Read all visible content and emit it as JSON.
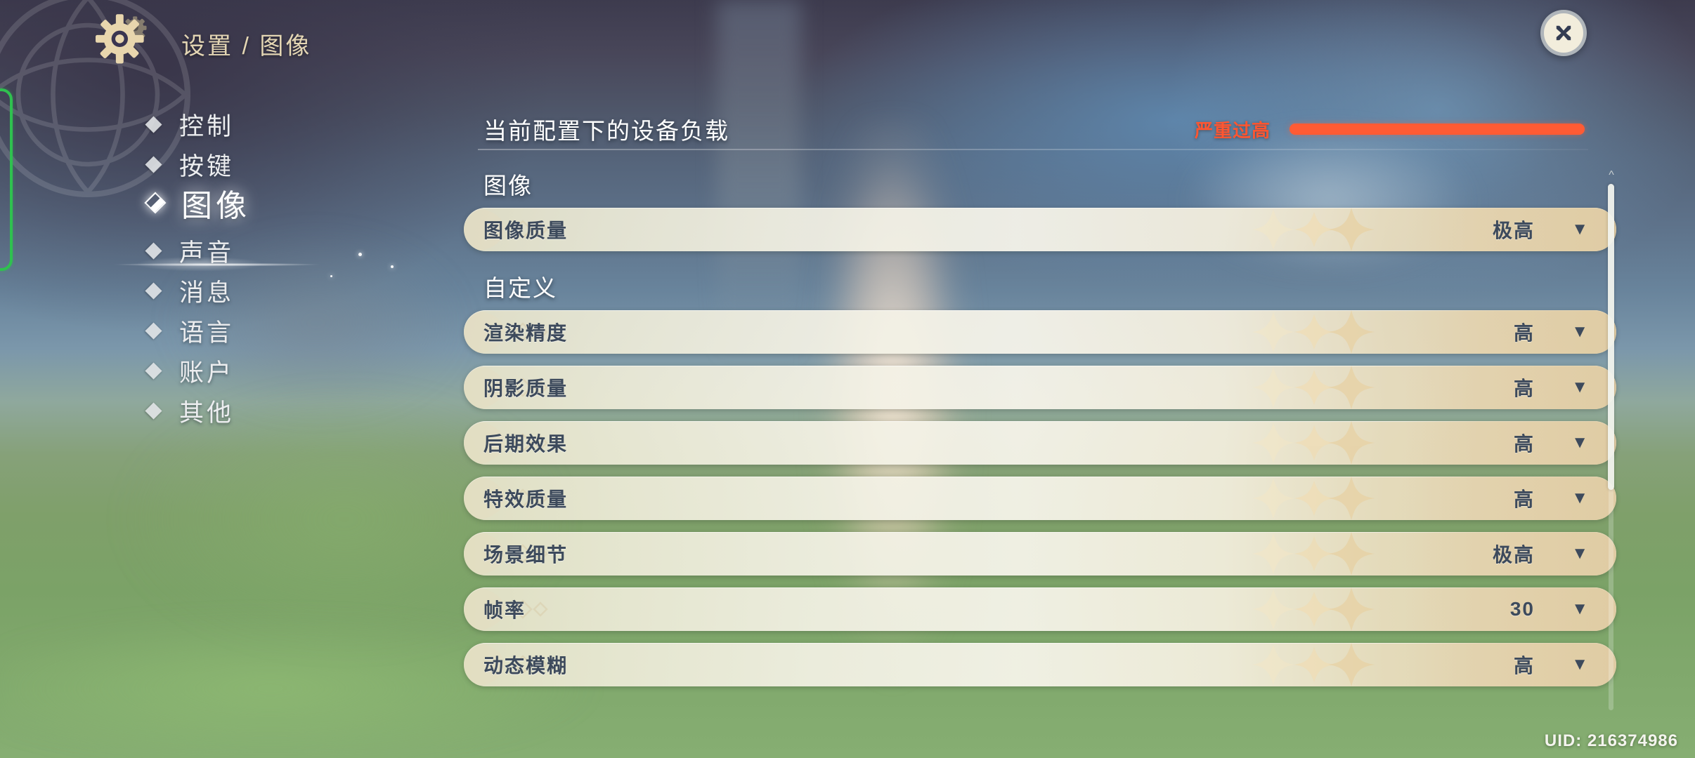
{
  "header": {
    "gear_icon": "gear-icon",
    "breadcrumb": "设置 / 图像",
    "close_label": "✕"
  },
  "sidebar": {
    "items": [
      {
        "label": "控制",
        "active": false
      },
      {
        "label": "按键",
        "active": false
      },
      {
        "label": "图像",
        "active": true
      },
      {
        "label": "声音",
        "active": false
      },
      {
        "label": "消息",
        "active": false
      },
      {
        "label": "语言",
        "active": false
      },
      {
        "label": "账户",
        "active": false
      },
      {
        "label": "其他",
        "active": false
      }
    ]
  },
  "device_load": {
    "title": "当前配置下的设备负载",
    "status": "严重过高",
    "status_color": "#ff5631",
    "bar_color": "#ff5b34",
    "bar_percent": 100
  },
  "sections": [
    {
      "title": "图像",
      "rows": [
        {
          "label": "图像质量",
          "value": "极高",
          "caret": "▼"
        }
      ]
    },
    {
      "title": "自定义",
      "rows": [
        {
          "label": "渲染精度",
          "value": "高",
          "caret": "▼"
        },
        {
          "label": "阴影质量",
          "value": "高",
          "caret": "▼"
        },
        {
          "label": "后期效果",
          "value": "高",
          "caret": "▼"
        },
        {
          "label": "特效质量",
          "value": "高",
          "caret": "▼"
        },
        {
          "label": "场景细节",
          "value": "极高",
          "caret": "▼"
        },
        {
          "label": "帧率",
          "value": "30",
          "caret": "▼"
        },
        {
          "label": "动态模糊",
          "value": "高",
          "caret": "▼"
        }
      ]
    }
  ],
  "footer": {
    "uid": "UID: 216374986"
  },
  "scrollbar": {
    "up_arrow": "^"
  }
}
